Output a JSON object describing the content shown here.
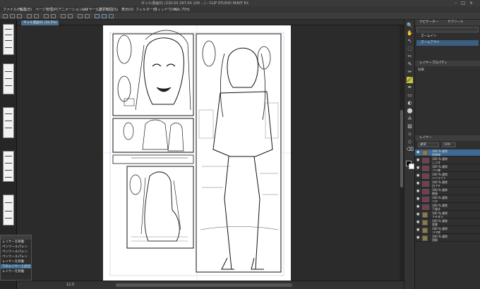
{
  "app": {
    "title": "ギャル漫画01 (220.0X 297.0X 100 ...) - CLIP STUDIO PAINT EX",
    "window_controls": [
      "–",
      "□",
      "×"
    ]
  },
  "menu": [
    "ファイル(F)",
    "編集(E)",
    "ページ管理(P)",
    "アニメーション(A)",
    "レイヤー(L)",
    "選択範囲(S)",
    "表示(V)",
    "フィルター(I)",
    "ウィンドウ(W)",
    "ヘルプ(H)"
  ],
  "tab": {
    "label": "ギャル漫画01 (34.5%)"
  },
  "status": {
    "zoom": "12.5"
  },
  "float_panel": {
    "items": [
      "レイヤーを移動",
      "ペンツールパレン",
      "ペンツールパレン",
      "ペンツールパレン",
      "レイヤーを移動",
      "下のレイヤーと結合",
      "レイヤーを移動"
    ],
    "selected_index": 5
  },
  "tools": [
    "🔍",
    "✋",
    "↖",
    "⬚",
    "✂",
    "✎",
    "✏",
    "🖌",
    "✒",
    "▭",
    "◐",
    "⬤",
    "A",
    "▨",
    "⬦",
    "◇",
    "⌫"
  ],
  "right": {
    "navigator_tab": "ナビゲーター",
    "sub_tab": "サブツール",
    "nav_items": [
      "ズームイン",
      "ズームアウト"
    ],
    "layer_prop": "レイヤープロパティ",
    "effect_label": "効果",
    "layers_header": "レイヤー",
    "blend_mode": "通常",
    "opacity": "100",
    "layers": [
      {
        "name": "100 % 通常",
        "sub": "効果線",
        "type": "folder"
      },
      {
        "name": "100 % 通常",
        "sub": "しぶき",
        "type": "layer"
      },
      {
        "name": "100 % 通常",
        "sub": "ブレ線",
        "type": "layer"
      },
      {
        "name": "100 % 通常",
        "sub": "ハイライト",
        "type": "layer"
      },
      {
        "name": "100 % 通常",
        "sub": "白フチ",
        "type": "layer"
      },
      {
        "name": "100 % 通常",
        "sub": "線画",
        "type": "layer"
      },
      {
        "name": "100 % 通常",
        "sub": "ベタ",
        "type": "layer"
      },
      {
        "name": "100 % 通常",
        "sub": "下描き",
        "type": "layer"
      },
      {
        "name": "100 % 通常",
        "sub": "フキダシ",
        "type": "folder"
      },
      {
        "name": "100 % 通常",
        "sub": "背景",
        "type": "folder"
      },
      {
        "name": "100 % 通常",
        "sub": "コマ枠",
        "type": "folder"
      },
      {
        "name": "100 % 通常",
        "sub": "用紙",
        "type": "folder"
      }
    ],
    "selected_layer": 0
  }
}
